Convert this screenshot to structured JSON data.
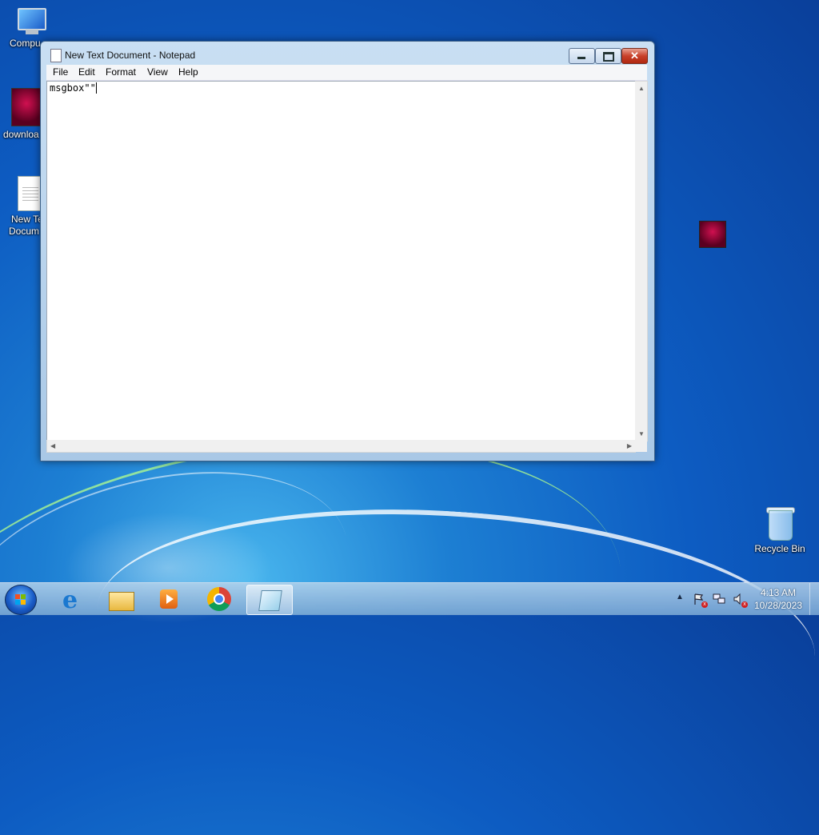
{
  "desktop": {
    "icons": [
      {
        "label": "Compu"
      },
      {
        "label": "downloa"
      },
      {
        "label": "New Te"
      },
      {
        "label": "Docum"
      }
    ],
    "recycle_bin": {
      "label": "Recycle Bin"
    }
  },
  "window": {
    "title": "New Text Document - Notepad",
    "menu": [
      "File",
      "Edit",
      "Format",
      "View",
      "Help"
    ],
    "content": "msgbox\"\""
  },
  "taskbar": {
    "apps": [
      "start-orb",
      "internet-explorer",
      "windows-explorer",
      "media-player",
      "chrome",
      "notepad"
    ],
    "clock": {
      "time": "4:13 AM",
      "date": "10/28/2023"
    },
    "colors": {
      "close_button": "#c8402a",
      "taskbar": "#7ea5d2"
    }
  }
}
